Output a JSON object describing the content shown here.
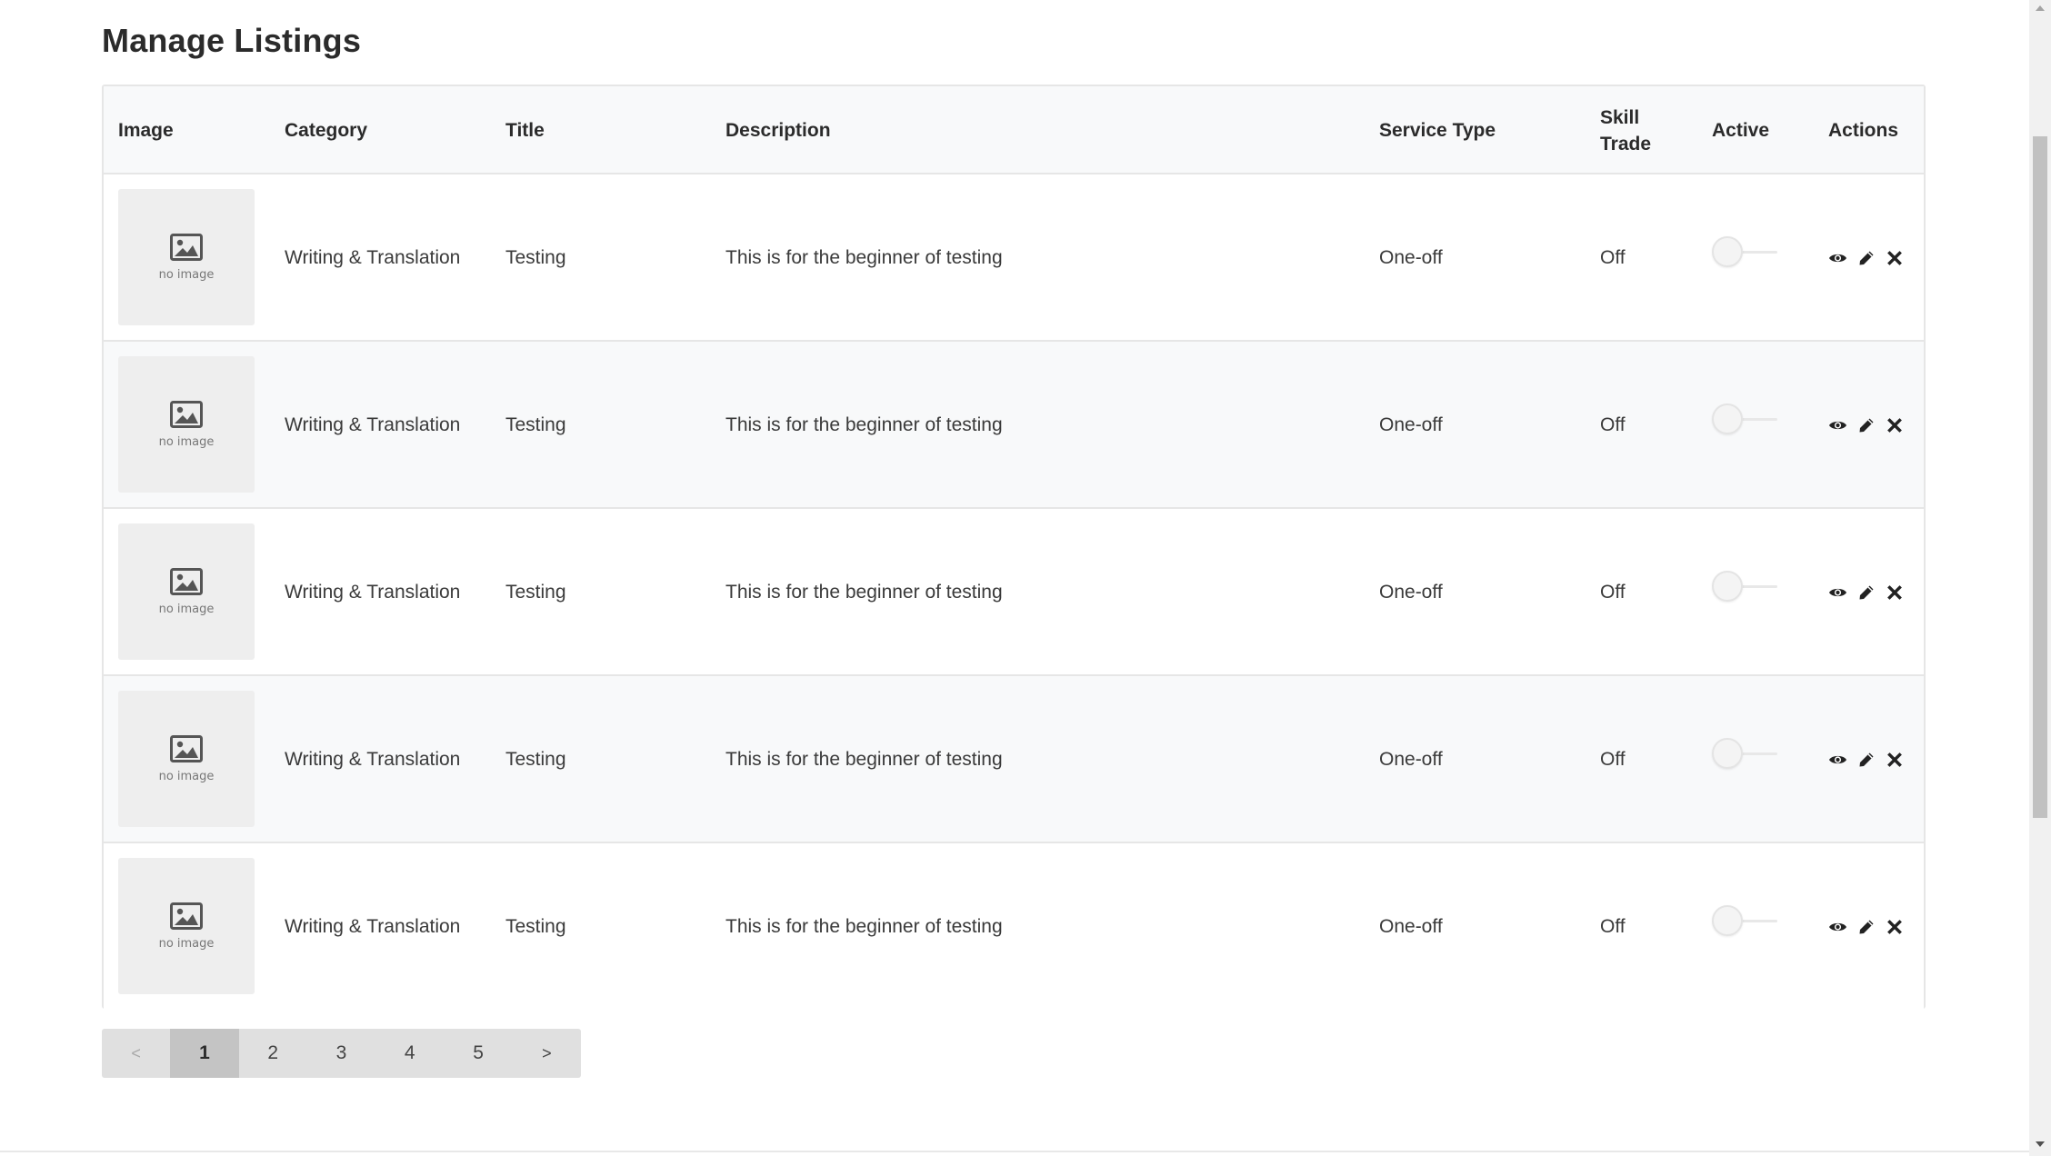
{
  "page": {
    "title": "Manage Listings"
  },
  "table": {
    "headers": {
      "image": "Image",
      "category": "Category",
      "title": "Title",
      "description": "Description",
      "service_type": "Service Type",
      "skill_trade_line1": "Skill",
      "skill_trade_line2": "Trade",
      "active": "Active",
      "actions": "Actions"
    },
    "rows": [
      {
        "image_label": "no image",
        "category": "Writing & Translation",
        "title": "Testing",
        "description": "This is for the beginner of testing",
        "service_type": "One-off",
        "skill_trade": "Off",
        "active": false
      },
      {
        "image_label": "no image",
        "category": "Writing & Translation",
        "title": "Testing",
        "description": "This is for the beginner of testing",
        "service_type": "One-off",
        "skill_trade": "Off",
        "active": false
      },
      {
        "image_label": "no image",
        "category": "Writing & Translation",
        "title": "Testing",
        "description": "This is for the beginner of testing",
        "service_type": "One-off",
        "skill_trade": "Off",
        "active": false
      },
      {
        "image_label": "no image",
        "category": "Writing & Translation",
        "title": "Testing",
        "description": "This is for the beginner of testing",
        "service_type": "One-off",
        "skill_trade": "Off",
        "active": false
      },
      {
        "image_label": "no image",
        "category": "Writing & Translation",
        "title": "Testing",
        "description": "This is for the beginner of testing",
        "service_type": "One-off",
        "skill_trade": "Off",
        "active": false
      }
    ],
    "action_icons": [
      "eye-icon",
      "pencil-icon",
      "close-icon"
    ]
  },
  "pagination": {
    "prev_label": "<",
    "next_label": ">",
    "pages": [
      "1",
      "2",
      "3",
      "4",
      "5"
    ],
    "current_page": "1"
  },
  "colors": {
    "header_bg": "#f8f9fa",
    "border": "#e6e6e6",
    "pager_bg": "#e0e0e0",
    "pager_active": "#c4c4c4",
    "text": "#333333"
  }
}
